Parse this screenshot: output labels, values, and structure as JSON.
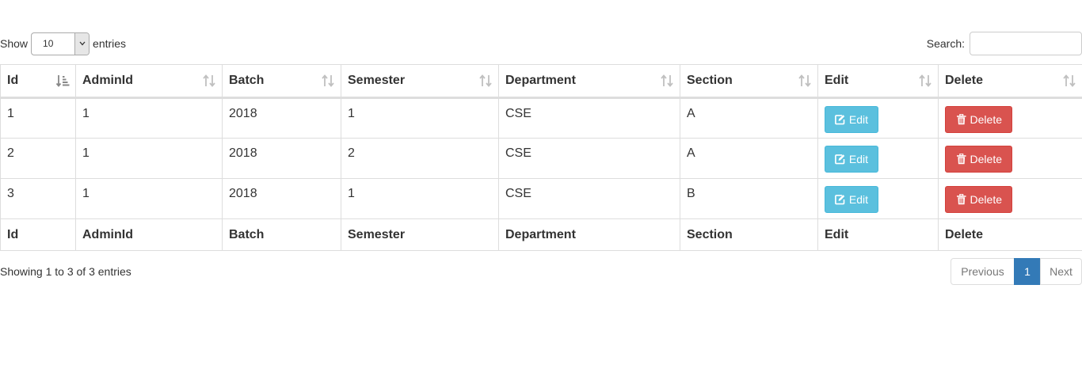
{
  "length_menu": {
    "show_label": "Show",
    "selected": "10",
    "entries_label": "entries"
  },
  "search": {
    "label": "Search:",
    "value": ""
  },
  "table": {
    "columns": [
      "Id",
      "AdminId",
      "Batch",
      "Semester",
      "Department",
      "Section",
      "Edit",
      "Delete"
    ],
    "rows": [
      {
        "id": "1",
        "admin_id": "1",
        "batch": "2018",
        "semester": "1",
        "department": "CSE",
        "section": "A"
      },
      {
        "id": "2",
        "admin_id": "1",
        "batch": "2018",
        "semester": "2",
        "department": "CSE",
        "section": "A"
      },
      {
        "id": "3",
        "admin_id": "1",
        "batch": "2018",
        "semester": "1",
        "department": "CSE",
        "section": "B"
      }
    ],
    "edit_label": "Edit",
    "delete_label": "Delete",
    "sorted_column": "Id"
  },
  "info": "Showing 1 to 3 of 3 entries",
  "pagination": {
    "previous": "Previous",
    "current": "1",
    "next": "Next"
  },
  "colors": {
    "edit_button": "#5bc0de",
    "delete_button": "#d9534f",
    "active_page": "#337ab7",
    "sort_icon": "#c0c0c0"
  }
}
